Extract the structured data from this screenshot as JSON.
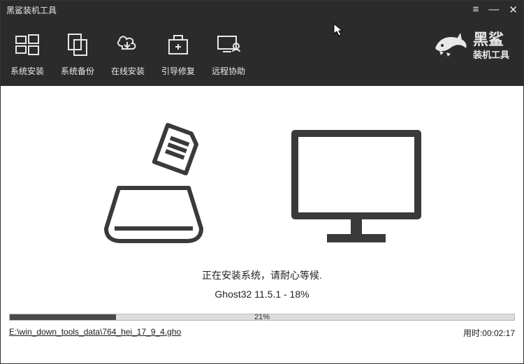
{
  "titlebar": {
    "title": "黑鲨装机工具"
  },
  "toolbar": {
    "items": [
      {
        "label": "系统安装"
      },
      {
        "label": "系统备份"
      },
      {
        "label": "在线安装"
      },
      {
        "label": "引导修复"
      },
      {
        "label": "远程协助"
      }
    ]
  },
  "logo": {
    "line1": "黑鲨",
    "line2": "装机工具"
  },
  "status": {
    "line1": "正在安装系统，请耐心等候.",
    "line2": "Ghost32 11.5.1 - 18%"
  },
  "progress": {
    "percent_text": "21%",
    "percent_value": 21
  },
  "footer": {
    "file_path": "E:\\win_down_tools_data\\764_hei_17_9_4.gho",
    "time_label": "用时:",
    "time_value": "00:02:17"
  }
}
